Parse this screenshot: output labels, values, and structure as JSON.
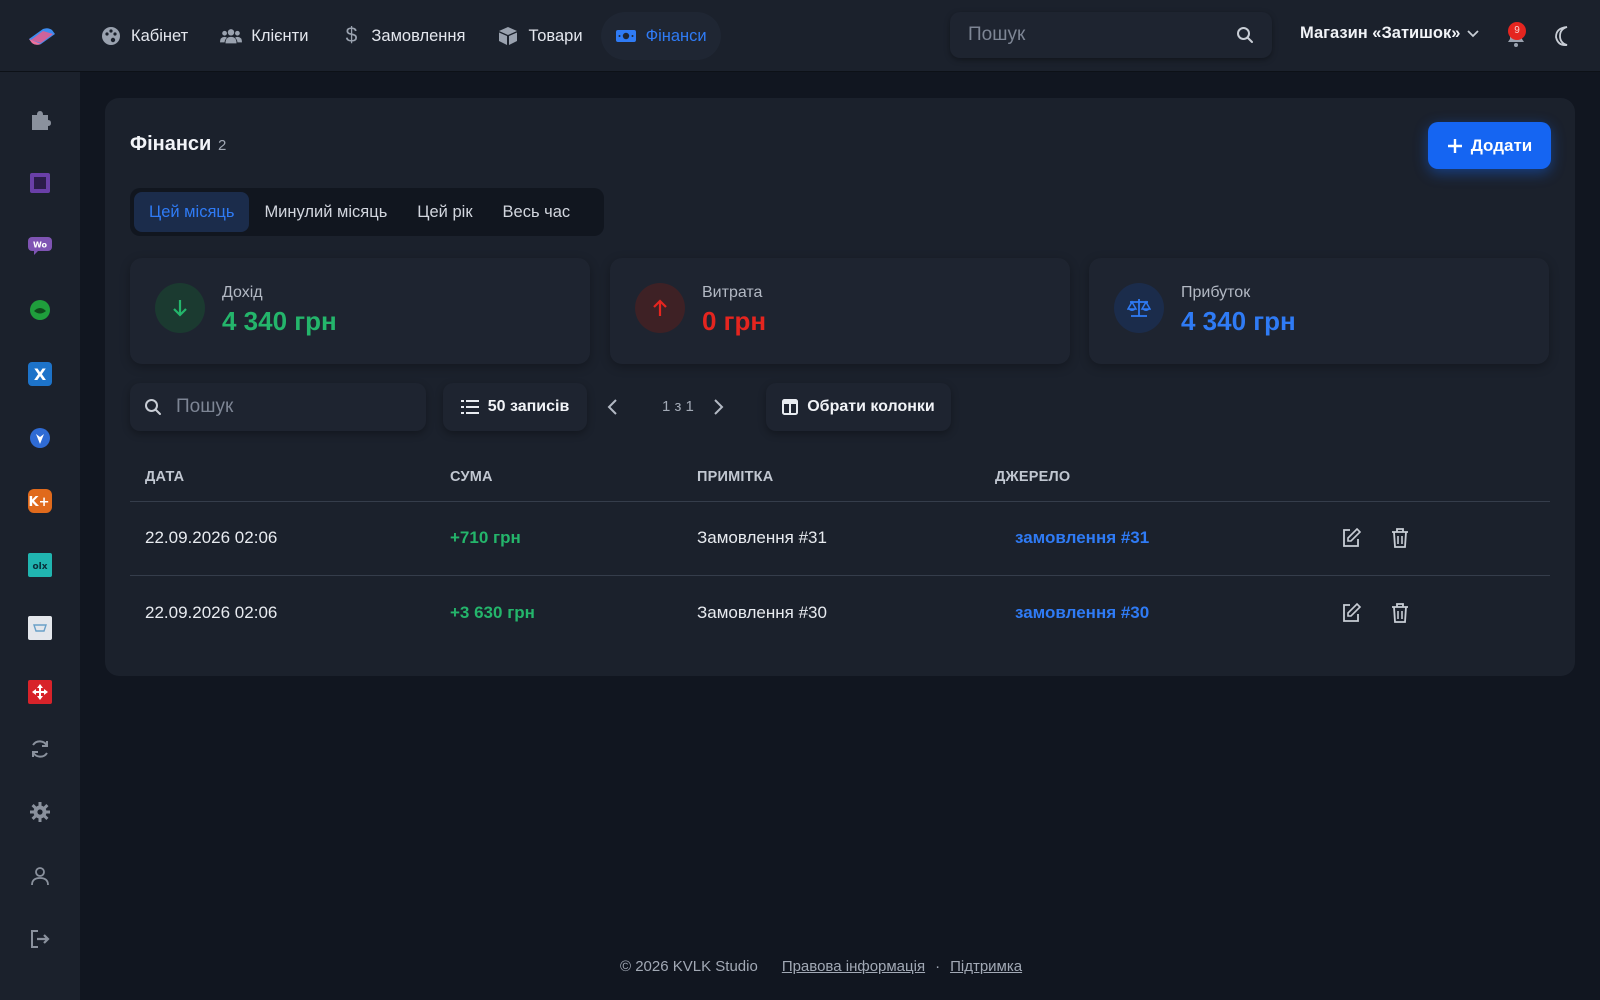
{
  "topbar": {
    "nav": [
      {
        "label": "Кабінет",
        "icon": "palette-icon"
      },
      {
        "label": "Клієнти",
        "icon": "users-icon"
      },
      {
        "label": "Замовлення",
        "icon": "dollar-icon"
      },
      {
        "label": "Товари",
        "icon": "box-icon"
      },
      {
        "label": "Фінанси",
        "icon": "money-icon",
        "active": true
      }
    ],
    "search_placeholder": "Пошук",
    "store_name": "Магазин «Затишок»",
    "notification_count": "9"
  },
  "sidebar": {
    "items": [
      "puzzle-icon",
      "square-app-icon",
      "woo-icon",
      "green-app-icon",
      "x-app-icon",
      "shield-app-icon",
      "k-app-icon",
      "olx-icon",
      "cart-app-icon",
      "red-app-icon",
      "sync-icon",
      "gear-icon",
      "user-icon",
      "logout-icon"
    ]
  },
  "page": {
    "title": "Фінанси",
    "count": "2",
    "add_label": "Додати",
    "tabs": [
      "Цей місяць",
      "Минулий місяць",
      "Цей рік",
      "Весь час"
    ],
    "active_tab": "Цей місяць"
  },
  "stats": {
    "income": {
      "label": "Дохід",
      "value": "4 340 грн",
      "color": "#24b56b"
    },
    "expense": {
      "label": "Витрата",
      "value": "0 грн",
      "color": "#e5251f"
    },
    "profit": {
      "label": "Прибуток",
      "value": "4 340 грн",
      "color": "#2f7bf5"
    }
  },
  "toolbar": {
    "search_placeholder": "Пошук",
    "per_page": "50 записів",
    "pager": "1 з 1",
    "columns": "Обрати колонки"
  },
  "table": {
    "headers": [
      "ДАТА",
      "СУМА",
      "ПРИМІТКА",
      "ДЖЕРЕЛО"
    ],
    "rows": [
      {
        "date": "22.09.2026 02:06",
        "sum": "+710 грн",
        "note": "Замовлення #31",
        "source": "замовлення #31"
      },
      {
        "date": "22.09.2026 02:06",
        "sum": "+3 630 грн",
        "note": "Замовлення #30",
        "source": "замовлення #30"
      }
    ]
  },
  "footer": {
    "copyright": "© 2026 KVLK Studio",
    "legal": "Правова інформація",
    "separator": "·",
    "support": "Підтримка"
  }
}
